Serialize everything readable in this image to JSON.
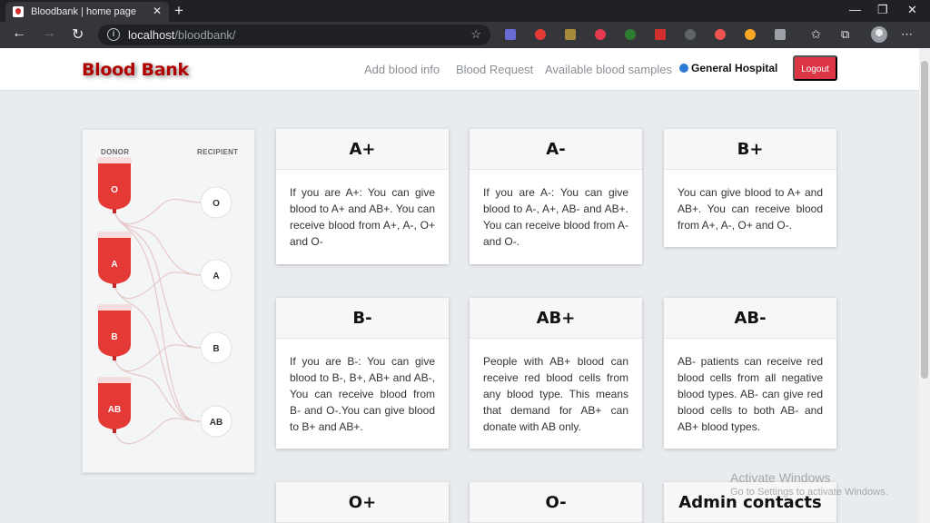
{
  "browser": {
    "tab_title": "Bloodbank | home page",
    "url_host": "localhost",
    "url_path": "/bloodbank/"
  },
  "navbar": {
    "brand": "Blood Bank",
    "links": [
      "Add blood info",
      "Blood Request",
      "Available blood samples"
    ],
    "hospital": "General Hospital",
    "logout": "Logout"
  },
  "compatibility": {
    "donor_label": "DONOR",
    "recipient_label": "RECIPIENT",
    "donors": [
      "O",
      "A",
      "B",
      "AB"
    ],
    "recipients": [
      "O",
      "A",
      "B",
      "AB"
    ],
    "bag_color": "#e53935"
  },
  "cards": [
    {
      "title": "A+",
      "text": "If you are A+: You can give blood to A+ and AB+. You can receive blood from A+, A-, O+ and O-"
    },
    {
      "title": "A-",
      "text": "If you are A-: You can give blood to A-, A+, AB- and AB+. You can receive blood from A- and O-."
    },
    {
      "title": "B+",
      "text": "You can give blood to A+ and AB+. You can receive blood from A+, A-, O+ and O-."
    },
    {
      "title": "B-",
      "text": "If you are B-: You can give blood to B-, B+, AB+ and AB-, You can receive blood from B- and O-.You can give blood to B+ and AB+."
    },
    {
      "title": "AB+",
      "text": "People with AB+ blood can receive red blood cells from any blood type. This means that demand for AB+ can donate with AB only."
    },
    {
      "title": "AB-",
      "text": "AB- patients can receive red blood cells from all negative blood types. AB- can give red blood cells to both AB- and AB+ blood types."
    },
    {
      "title": "O+",
      "text": ""
    },
    {
      "title": "O-",
      "text": ""
    },
    {
      "title": "Admin contacts",
      "text": ""
    }
  ],
  "watermark": {
    "line1": "Activate Windows",
    "line2": "Go to Settings to activate Windows."
  },
  "colors": {
    "brand": "#b00000",
    "logout": "#dc3545"
  }
}
